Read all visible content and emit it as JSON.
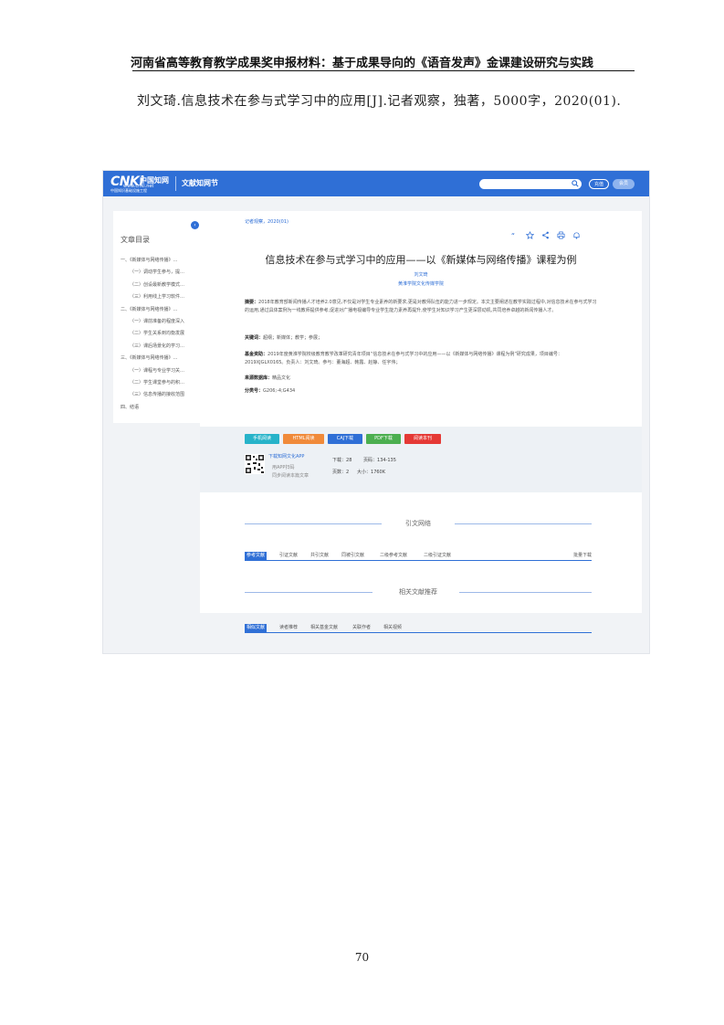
{
  "document": {
    "header": "河南省高等教育教学成果奖申报材料：基于成果导向的《语音发声》金课建设研究与实践",
    "citation": "刘文琦.信息技术在参与式学习中的应用[J].记者观察，独著，5000字，2020(01).",
    "page_number": "70"
  },
  "cnki": {
    "logo_mark": "CNKi",
    "logo_cn": "中国知网",
    "logo_url": "www.cnki.net",
    "logo_sub": "中国知识基础设施工程",
    "section": "文献知网节",
    "login": "充值",
    "register": "会员",
    "brand_color": "#2f6fd6"
  },
  "toc": {
    "title": "文章目录",
    "items": [
      {
        "text": "一、《新媒体与网络传播》…",
        "level": 1
      },
      {
        "text": "（一）调动学生参与，提…",
        "level": 2
      },
      {
        "text": "（二）创设最新教学模式…",
        "level": 2
      },
      {
        "text": "（三）利用线上学习软件…",
        "level": 2
      },
      {
        "text": "二、《新媒体与网络传播》…",
        "level": 1
      },
      {
        "text": "（一）课前准备的程度深入",
        "level": 2
      },
      {
        "text": "（二）学生关系到均衡发展",
        "level": 2
      },
      {
        "text": "（三）课后场景化的学习…",
        "level": 2
      },
      {
        "text": "三、《新媒体与网络传播》…",
        "level": 1
      },
      {
        "text": "（一）课程与专业学习关…",
        "level": 2
      },
      {
        "text": "（二）学生课堂参与的积…",
        "level": 2
      },
      {
        "text": "（三）信息传播的接收范围",
        "level": 2
      },
      {
        "text": "四、结语",
        "level": 1
      }
    ]
  },
  "article": {
    "breadcrumb": "记者观察，2020(01)",
    "title": "信息技术在参与式学习中的应用——以《新媒体与网络传播》课程为例",
    "author": "刘文琦",
    "affiliation": "黄淮学院文化传媒学院",
    "abstract_label": "摘要：",
    "abstract": "2018年教育部新闻传播人才培养2.0意见,不仅是对学生专业素养的新要求,更是对教师队伍的能力进一步规定。本文主要阐述在教学实践过程中,对信息技术在参与式学习的运用,通过具体案例为一线教师提供参考,促进对广播电视编导专业学生能力素养再提升,使学生对知识学习产生更深层动机,共同培养卓越的新闻传播人才。",
    "keywords_label": "关键词：",
    "keywords": "超纲；新媒体；教学；参展；",
    "fund_label": "基金资助：",
    "fund": "2019年度黄淮学院校级教育教学改革研究青年项目“信息技术在参与式学习中的应用——以《新媒体与网络传播》课程为例”研究成果，项目编号：2019XJGLX0165。负责人：刘文琦。参与：董海超、韩露、赵静、任宇伟；",
    "source_label": "来源数据库：",
    "source": "精品文化",
    "class_label": "分类号：",
    "class_no": "G206;-4;G434"
  },
  "downloads": {
    "buttons": [
      {
        "label": "手机阅读",
        "color": "#27b3c9"
      },
      {
        "label": "HTML阅读",
        "color": "#f08a3a"
      },
      {
        "label": "CAJ下载",
        "color": "#2f6fd6"
      },
      {
        "label": "PDF下载",
        "color": "#4caf50"
      },
      {
        "label": "阅读本刊",
        "color": "#e53935"
      }
    ],
    "app_link": "下载知网文化APP",
    "app_tip1": "用APP扫码",
    "app_tip2": "同步阅读本篇文章",
    "downloads_label": "下载：",
    "downloads_value": "28",
    "pages_label": "页码：",
    "pages_value": "134-135",
    "page_count_label": "页数：",
    "page_count_value": "2",
    "size_label": "大小：",
    "size_value": "1760K"
  },
  "citation_network": {
    "title": "引文网络",
    "tabs": [
      "参考文献",
      "引证文献",
      "共引文献",
      "同被引文献",
      "二级参考文献",
      "二级引证文献"
    ],
    "batch_download": "批量下载"
  },
  "related": {
    "title": "相关文献推荐",
    "tabs": [
      "相似文献",
      "读者推荐",
      "相关基金文献",
      "关联作者",
      "相关视频"
    ]
  }
}
